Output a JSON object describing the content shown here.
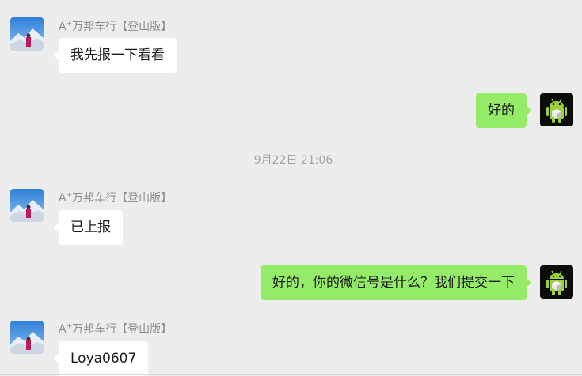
{
  "chat": {
    "sender_prefix": "A",
    "sender_sup": "+",
    "sender_rest": "万邦车行【登山版】",
    "timestamp": "9月22日 21:06"
  },
  "messages": [
    {
      "side": "left",
      "text": "我先报一下看看"
    },
    {
      "side": "right",
      "text": "好的"
    },
    {
      "side": "left",
      "text": "已上报"
    },
    {
      "side": "right",
      "text": "好的，你的微信号是什么？我们提交一下"
    },
    {
      "side": "left",
      "text": "Loya0607"
    }
  ],
  "icons": {
    "contact_avatar": "mountain-skier-photo",
    "self_avatar": "android-robot-icon"
  },
  "colors": {
    "background": "#ededed",
    "incoming_bubble": "#ffffff",
    "outgoing_bubble": "#95ec69",
    "sender_name": "#8c8c8c",
    "timestamp": "#a3a3a3"
  }
}
